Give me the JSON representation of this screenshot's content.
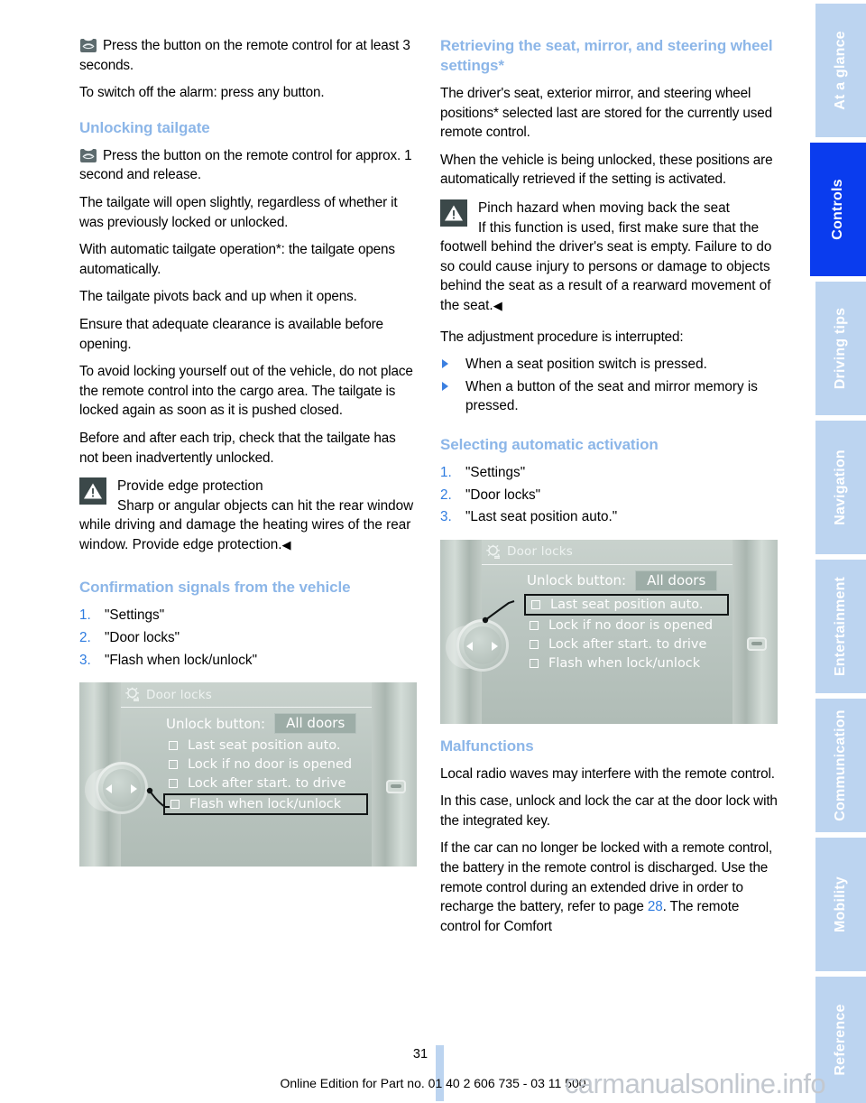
{
  "page": {
    "number": "31",
    "footer": "Online Edition for Part no. 01 40 2 606 735 - 03 11 500",
    "watermark": "carmanualsonline.info"
  },
  "colors": {
    "heading_blue": "#8cb6e8",
    "link_blue": "#2f7ce0",
    "tab_inactive": "#bcd4f0",
    "tab_active": "#0a3cee",
    "warning_icon_bg": "#3b4849"
  },
  "left_column": {
    "remote_icon_name": "tailgate-remote-icon",
    "intro": {
      "line1": "Press the button on the remote control for at least 3 seconds.",
      "line2": "To switch off the alarm: press any button."
    },
    "unlocking_tailgate": {
      "heading": "Unlocking tailgate",
      "icon_line": "Press the button on the remote control for approx. 1 second and release.",
      "paragraphs": [
        "The tailgate will open slightly, regardless of whether it was previously locked or unlocked.",
        "With automatic tailgate operation*: the tailgate opens automatically.",
        "The tailgate pivots back and up when it opens.",
        "Ensure that adequate clearance is available before opening.",
        "To avoid locking yourself out of the vehicle, do not place the remote control into the cargo area. The tailgate is locked again as soon as it is pushed closed.",
        "Before and after each trip, check that the tailgate has not been inadvertently unlocked."
      ]
    },
    "warning": {
      "icon_name": "warning-triangle-icon",
      "title": "Provide edge protection",
      "body": "Sharp or angular objects can hit the rear window while driving and damage the heating wires of the rear window. Provide edge protection.",
      "end_mark": "◀"
    },
    "confirmation": {
      "heading": "Confirmation signals from the vehicle",
      "steps": [
        {
          "num": "1.",
          "text": "\"Settings\""
        },
        {
          "num": "2.",
          "text": "\"Door locks\""
        },
        {
          "num": "3.",
          "text": "\"Flash when lock/unlock\""
        }
      ]
    },
    "idrive": {
      "title": "Door locks",
      "gear_icon": "settings-gear-icon",
      "unlock_label": "Unlock button:",
      "unlock_value": "All doors",
      "options": [
        {
          "label": "Last seat position auto.",
          "selected": false
        },
        {
          "label": "Lock if no door is opened",
          "selected": false
        },
        {
          "label": "Lock after start. to drive",
          "selected": false
        },
        {
          "label": "Flash when lock/unlock",
          "selected": true
        }
      ]
    }
  },
  "right_column": {
    "retrieving": {
      "heading": "Retrieving the seat, mirror, and steering wheel settings*",
      "paragraphs": [
        "The driver's seat, exterior mirror, and steering wheel positions* selected last are stored for the currently used remote control.",
        "When the vehicle is being unlocked, these positions are automatically retrieved if the setting is activated."
      ]
    },
    "warning": {
      "icon_name": "warning-triangle-icon",
      "title": "Pinch hazard when moving back the seat",
      "body": "If this function is used, first make sure that the footwell behind the driver's seat is empty. Failure to do so could cause injury to persons or damage to objects behind the seat as a result of a rearward movement of the seat.",
      "end_mark": "◀"
    },
    "interrupt": {
      "lead": "The adjustment procedure is interrupted:",
      "items": [
        "When a seat position switch is pressed.",
        "When a button of the seat and mirror memory is pressed."
      ]
    },
    "selecting": {
      "heading": "Selecting automatic activation",
      "steps": [
        {
          "num": "1.",
          "text": "\"Settings\""
        },
        {
          "num": "2.",
          "text": "\"Door locks\""
        },
        {
          "num": "3.",
          "text": "\"Last seat position auto.\""
        }
      ]
    },
    "idrive": {
      "title": "Door locks",
      "gear_icon": "settings-gear-icon",
      "unlock_label": "Unlock button:",
      "unlock_value": "All doors",
      "options": [
        {
          "label": "Last seat position auto.",
          "selected": true
        },
        {
          "label": "Lock if no door is opened",
          "selected": false
        },
        {
          "label": "Lock after start. to drive",
          "selected": false
        },
        {
          "label": "Flash when lock/unlock",
          "selected": false
        }
      ]
    },
    "malfunctions": {
      "heading": "Malfunctions",
      "paragraphs": [
        "Local radio waves may interfere with the remote control.",
        "In this case, unlock and lock the car at the door lock with the integrated key."
      ],
      "last_paragraph": {
        "before": "If the car can no longer be locked with a remote control, the battery in the remote control is discharged. Use the remote control during an extended drive in order to recharge the battery, refer to page ",
        "page_ref": "28",
        "after": ". The remote control for Comfort"
      }
    }
  },
  "tabs": [
    {
      "label": "At a glance",
      "active": false
    },
    {
      "label": "Controls",
      "active": true
    },
    {
      "label": "Driving tips",
      "active": false
    },
    {
      "label": "Navigation",
      "active": false
    },
    {
      "label": "Entertainment",
      "active": false
    },
    {
      "label": "Communication",
      "active": false
    },
    {
      "label": "Mobility",
      "active": false
    },
    {
      "label": "Reference",
      "active": false
    }
  ]
}
